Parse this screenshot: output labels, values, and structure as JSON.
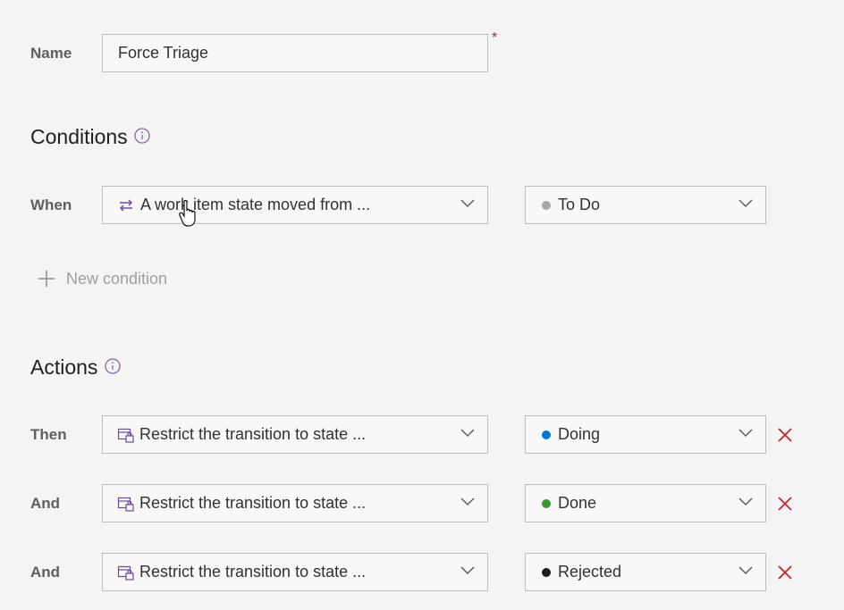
{
  "name_row": {
    "label": "Name",
    "value": "Force Triage",
    "required_mark": "*"
  },
  "conditions": {
    "title": "Conditions",
    "info_icon": "info-icon",
    "rows": [
      {
        "label": "When",
        "trigger": "A work item state moved from ...",
        "trigger_icon": "swap-arrows-icon",
        "state": "To Do",
        "state_color": "#a6a6a6"
      }
    ],
    "new_condition_label": "New condition"
  },
  "actions": {
    "title": "Actions",
    "info_icon": "info-icon",
    "rows": [
      {
        "label": "Then",
        "action": "Restrict the transition to state ...",
        "action_icon": "restrict-transition-icon",
        "state": "Doing",
        "state_color": "#0078d4"
      },
      {
        "label": "And",
        "action": "Restrict the transition to state ...",
        "action_icon": "restrict-transition-icon",
        "state": "Done",
        "state_color": "#339933"
      },
      {
        "label": "And",
        "action": "Restrict the transition to state ...",
        "action_icon": "restrict-transition-icon",
        "state": "Rejected",
        "state_color": "#201f1e"
      }
    ]
  },
  "colors": {
    "delete": "#c4262e",
    "required": "#a4262c",
    "icon": "#8a5fb3"
  }
}
